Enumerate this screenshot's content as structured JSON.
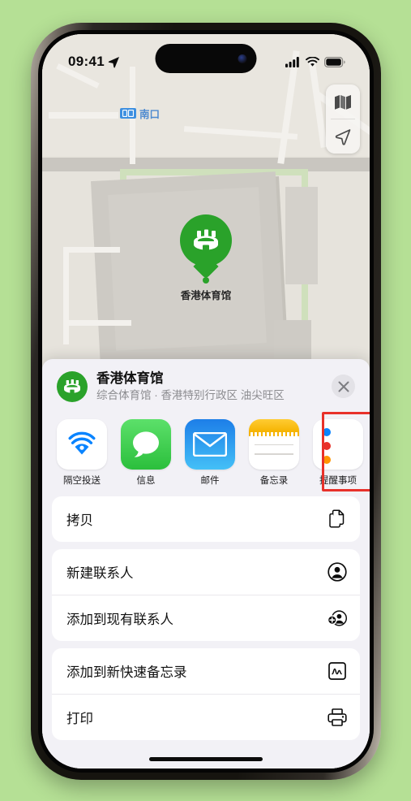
{
  "status_bar": {
    "time": "09:41",
    "location_arrow_icon": "location-arrow-icon",
    "cellular_icon": "cellular-bars-icon",
    "wifi_icon": "wifi-icon",
    "battery_icon": "battery-full-icon"
  },
  "map": {
    "poi_pin_label": "香港体育馆",
    "poi_pin_icon": "stadium-icon",
    "transit_label": "南口",
    "transit_icon": "subway-station-icon",
    "controls": [
      {
        "name": "map-layers-button",
        "icon": "map-layers-icon"
      },
      {
        "name": "locate-me-button",
        "icon": "navigation-arrow-icon"
      }
    ],
    "accent_green": "#2aa22a"
  },
  "share_sheet": {
    "title": "香港体育馆",
    "subtitle": "综合体育馆 · 香港特别行政区 油尖旺区",
    "poi_icon": "stadium-icon",
    "close_icon": "close-icon",
    "apps": [
      {
        "label": "隔空投送",
        "icon": "airdrop-icon",
        "highlighted": false
      },
      {
        "label": "信息",
        "icon": "messages-icon",
        "highlighted": false
      },
      {
        "label": "邮件",
        "icon": "mail-icon",
        "highlighted": false
      },
      {
        "label": "备忘录",
        "icon": "notes-icon",
        "highlighted": true
      },
      {
        "label": "提醒事项",
        "icon": "reminders-icon",
        "highlighted": false
      }
    ],
    "highlight_color": "#e8312a",
    "actions": [
      {
        "label": "拷贝",
        "icon": "copy-documents-icon"
      },
      {
        "label": "新建联系人",
        "icon": "person-circle-icon"
      },
      {
        "label": "添加到现有联系人",
        "icon": "person-badge-plus-icon"
      },
      {
        "label": "添加到新快速备忘录",
        "icon": "quick-note-icon"
      },
      {
        "label": "打印",
        "icon": "printer-icon"
      }
    ]
  }
}
